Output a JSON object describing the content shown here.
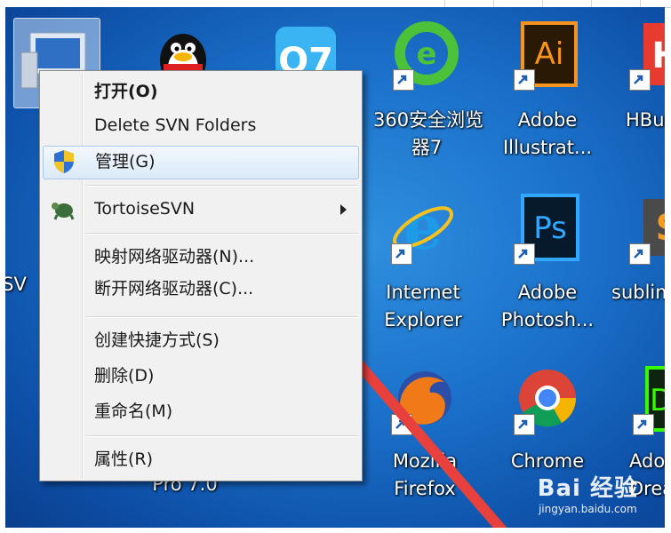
{
  "context_menu": {
    "items": [
      {
        "label": "打开(O)",
        "bold": true
      },
      {
        "label": "Delete SVN Folders"
      },
      {
        "label": "管理(G)",
        "highlighted": true,
        "icon": "uac-shield-icon"
      },
      {
        "label": "TortoiseSVN",
        "icon": "tortoise-svn-icon",
        "submenu": true
      },
      {
        "label": "映射网络驱动器(N)..."
      },
      {
        "label": "断开网络驱动器(C)..."
      },
      {
        "label": "创建快捷方式(S)"
      },
      {
        "label": "删除(D)"
      },
      {
        "label": "重命名(M)"
      },
      {
        "label": "属性(R)"
      }
    ]
  },
  "desktop_icons": [
    {
      "name": "computer-icon",
      "label": ""
    },
    {
      "name": "qq-icon",
      "label": ""
    },
    {
      "name": "qq-browser-icon",
      "label": ""
    },
    {
      "name": "ie-360-icon",
      "label1": "360安全浏览",
      "label2": "器7"
    },
    {
      "name": "adobe-illustrator-icon",
      "label1": "Adobe",
      "label2": "Illustrat..."
    },
    {
      "name": "hbuilder-icon",
      "label1": "HBu",
      "label2": ""
    },
    {
      "name": "svn-icon",
      "label1": "SV",
      "label2": ""
    },
    {
      "name": "internet-explorer-icon",
      "label1": "Internet",
      "label2": "Explorer"
    },
    {
      "name": "adobe-photoshop-icon",
      "label1": "Adobe",
      "label2": "Photosh..."
    },
    {
      "name": "sublime-icon",
      "label1": "sublim",
      "label2": ""
    },
    {
      "name": "pro7-icon",
      "label1": "Pro 7.0",
      "label2": ""
    },
    {
      "name": "firefox-icon",
      "label1": "Mozilla",
      "label2": "Firefox"
    },
    {
      "name": "chrome-icon",
      "label1": "Chrome",
      "label2": ""
    },
    {
      "name": "dreamweaver-icon",
      "label1": "Ado",
      "label2": "Drear"
    }
  ],
  "watermark": {
    "logo": "Bai 经验",
    "url": "jingyan.baidu.com"
  },
  "colors": {
    "desktop": "#1a6fc8",
    "menu_bg": "#f1f1f1",
    "highlight": "#dbe9f8",
    "arrow": "#e8403c"
  }
}
